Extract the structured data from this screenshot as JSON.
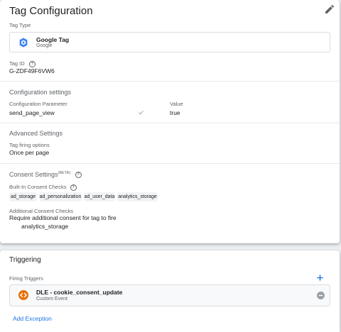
{
  "tag_config": {
    "title": "Tag Configuration",
    "tag_type_label": "Tag Type",
    "tag_type_name": "Google Tag",
    "tag_type_sub": "Google",
    "tag_id_label": "Tag ID",
    "tag_id_value": "G-ZDF49F6VW6"
  },
  "config_settings": {
    "heading": "Configuration settings",
    "param_header": "Configuration Parameter",
    "value_header": "Value",
    "param": "send_page_view",
    "value": "true"
  },
  "advanced": {
    "heading": "Advanced Settings",
    "firing_label": "Tag firing options",
    "firing_value": "Once per page"
  },
  "consent": {
    "heading": "Consent Settings",
    "beta": "(BETA)",
    "builtin_label": "Built-In Consent Checks",
    "chips": [
      "ad_storage",
      "ad_personalization",
      "ad_user_data",
      "analytics_storage"
    ],
    "additional_label": "Additional Consent Checks",
    "additional_value": "Require additional consent for tag to fire",
    "additional_item": "analytics_storage"
  },
  "triggering": {
    "title": "Triggering",
    "firing_label": "Firing Triggers",
    "trigger_name": "DLE - cookie_consent_update",
    "trigger_sub": "Custom Event",
    "add_exception": "Add Exception"
  },
  "colors": {
    "accent": "#1a73e8",
    "trigger_icon": "#e8710a",
    "google_tag_icon": "#4285f4"
  }
}
